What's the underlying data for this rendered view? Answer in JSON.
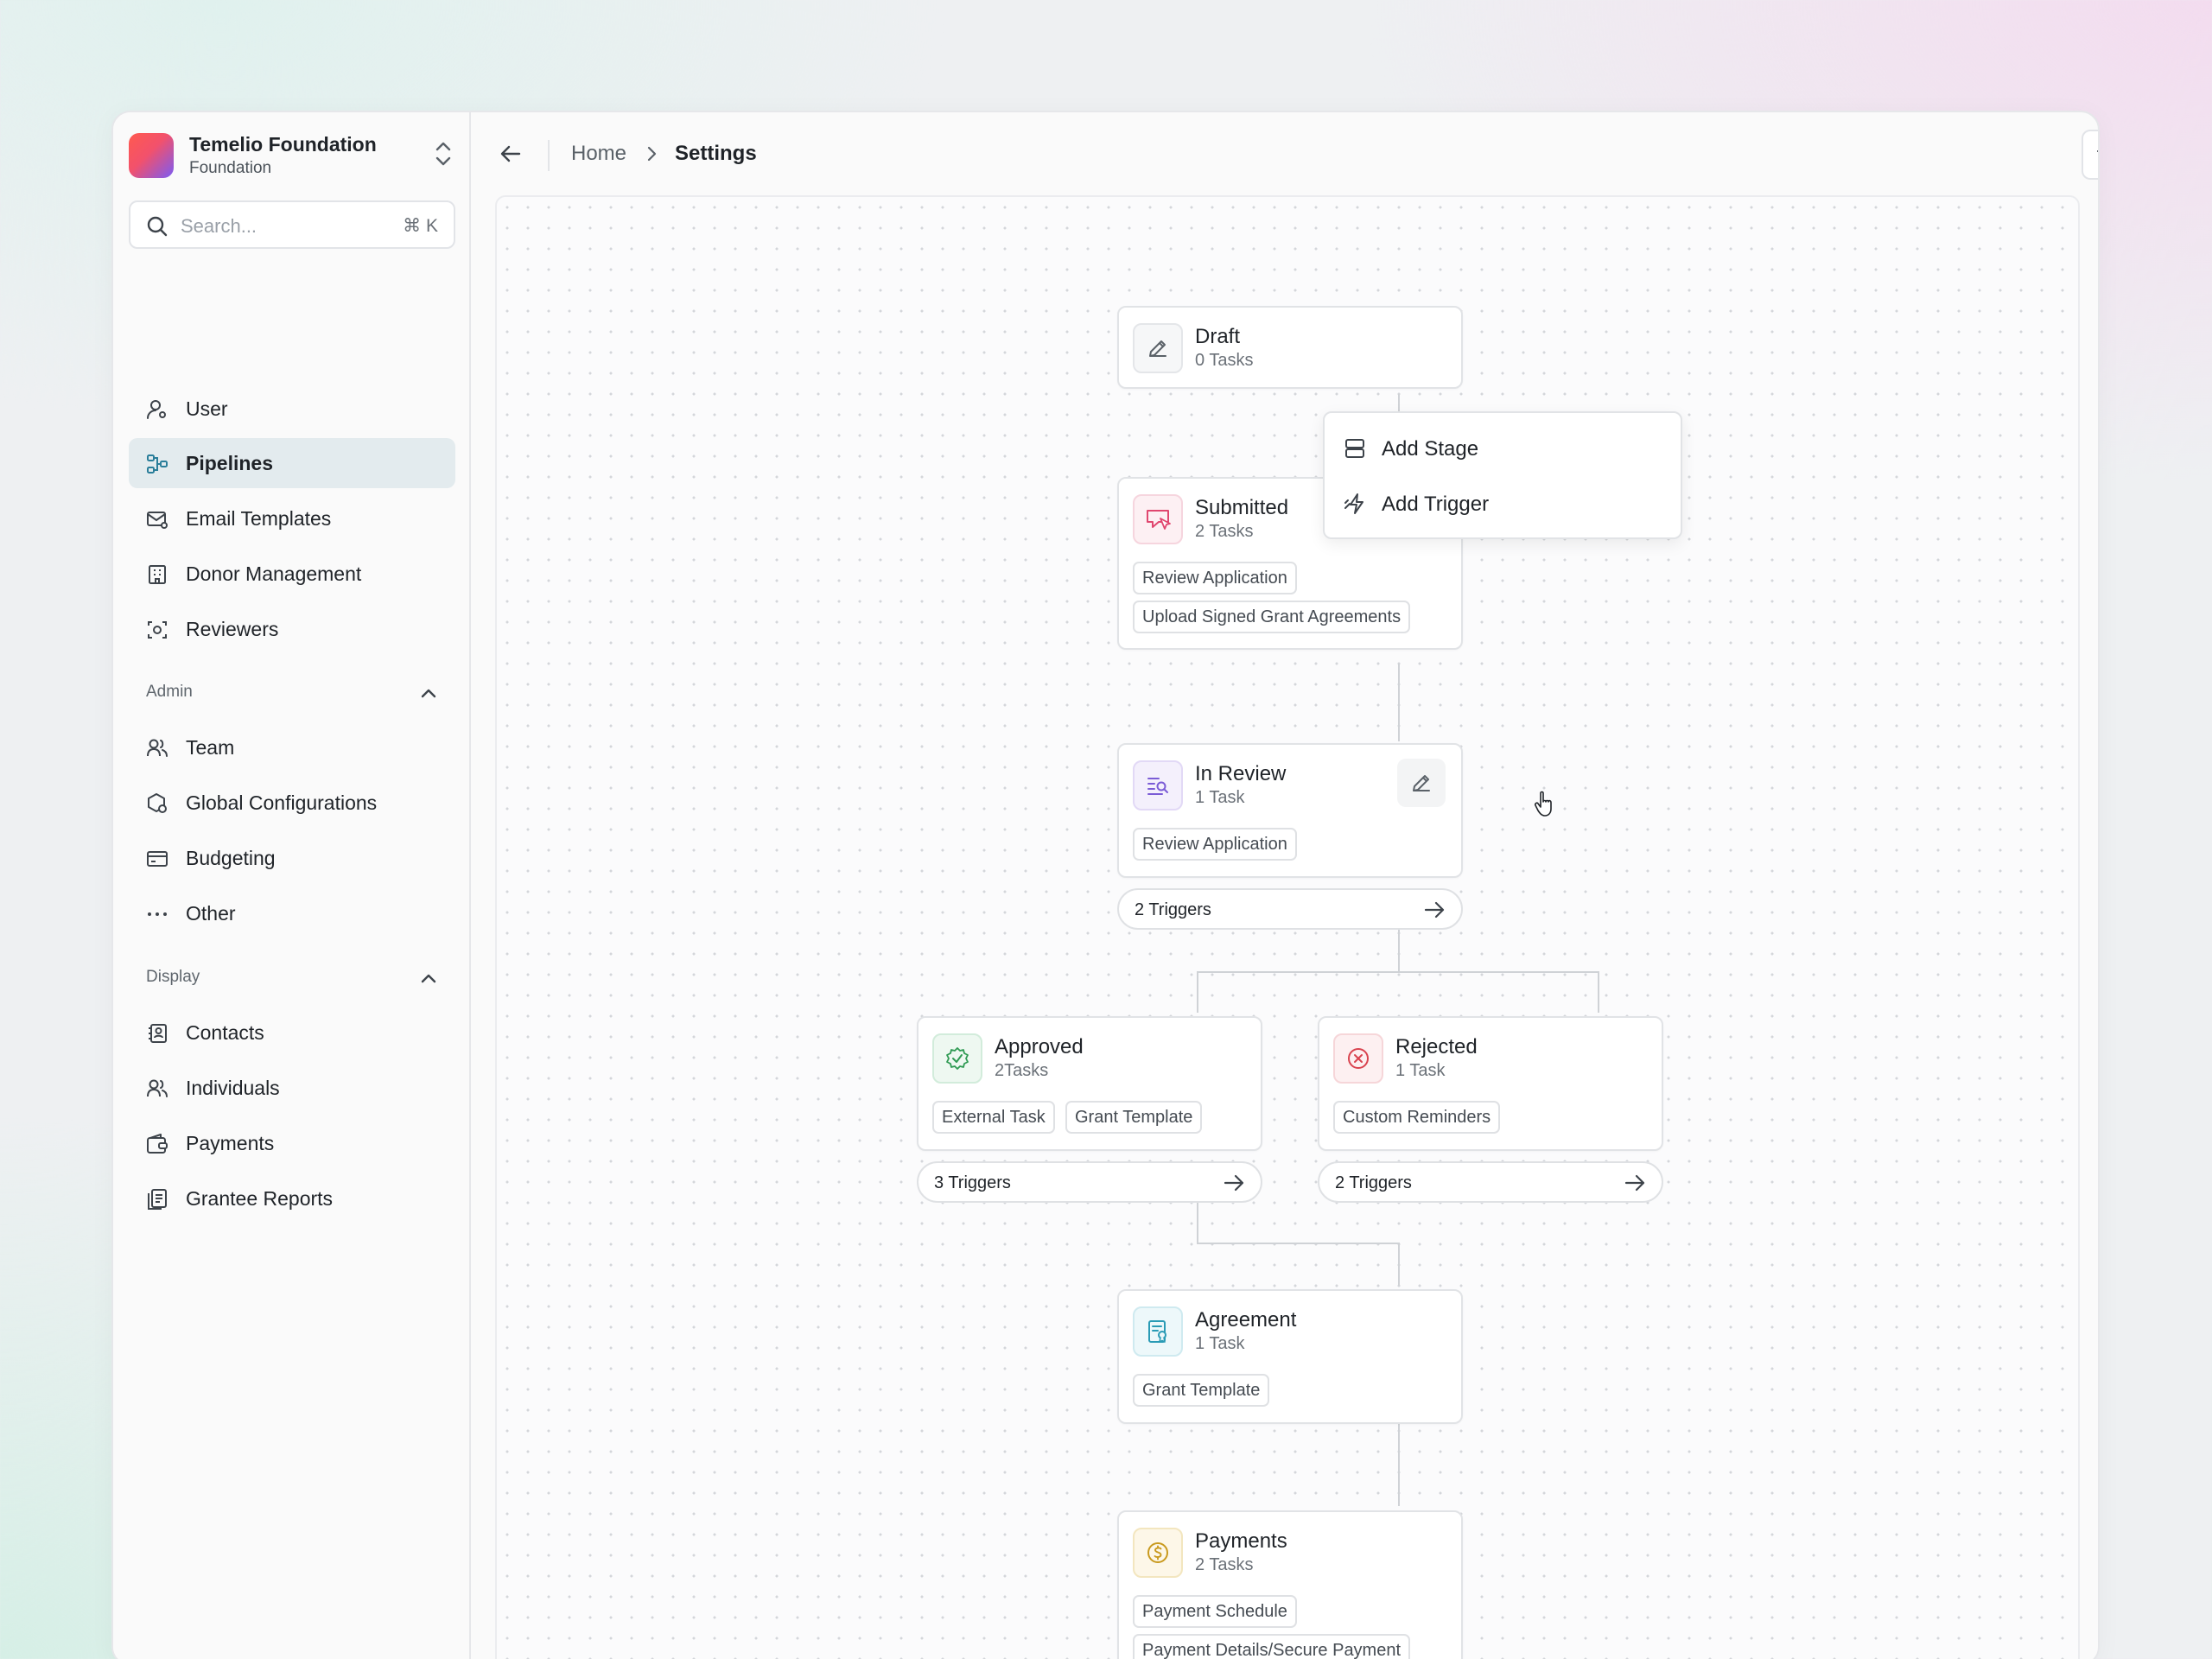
{
  "org": {
    "name": "Temelio Foundation",
    "type": "Foundation"
  },
  "search": {
    "placeholder": "Search...",
    "shortcut": "⌘ K"
  },
  "nav": {
    "main": [
      {
        "label": "User",
        "icon": "user-settings-icon"
      },
      {
        "label": "Pipelines",
        "icon": "pipeline-icon",
        "active": true
      },
      {
        "label": "Email Templates",
        "icon": "email-template-icon"
      },
      {
        "label": "Donor Management",
        "icon": "building-icon"
      },
      {
        "label": "Reviewers",
        "icon": "reviewer-icon"
      }
    ],
    "admin_label": "Admin",
    "admin": [
      {
        "label": "Team",
        "icon": "team-icon"
      },
      {
        "label": "Global Configurations",
        "icon": "config-icon"
      },
      {
        "label": "Budgeting",
        "icon": "budget-icon"
      },
      {
        "label": "Other",
        "icon": "more-icon"
      }
    ],
    "display_label": "Display",
    "display": [
      {
        "label": "Contacts",
        "icon": "contacts-icon"
      },
      {
        "label": "Individuals",
        "icon": "individuals-icon"
      },
      {
        "label": "Payments",
        "icon": "wallet-icon"
      },
      {
        "label": "Grantee Reports",
        "icon": "reports-icon"
      }
    ]
  },
  "breadcrumb": {
    "home": "Home",
    "current": "Settings"
  },
  "menu": {
    "add_stage": "Add Stage",
    "add_trigger": "Add Trigger"
  },
  "stages": {
    "draft": {
      "title": "Draft",
      "tasks": "0 Tasks"
    },
    "submitted": {
      "title": "Submitted",
      "tasks": "2 Tasks",
      "tags": [
        "Review Application",
        "Upload Signed Grant Agreements"
      ]
    },
    "in_review": {
      "title": "In Review",
      "tasks": "1 Task",
      "tags": [
        "Review Application"
      ],
      "triggers": "2 Triggers"
    },
    "approved": {
      "title": "Approved",
      "tasks": "2Tasks",
      "tags": [
        "External Task",
        "Grant Template"
      ],
      "triggers": "3 Triggers"
    },
    "rejected": {
      "title": "Rejected",
      "tasks": "1 Task",
      "tags": [
        "Custom Reminders"
      ],
      "triggers": "2 Triggers"
    },
    "agreement": {
      "title": "Agreement",
      "tasks": "1 Task",
      "tags": [
        "Grant Template"
      ]
    },
    "payments": {
      "title": "Payments",
      "tasks": "2 Tasks",
      "tags": [
        "Payment Schedule",
        "Payment Details/Secure Payment"
      ]
    }
  },
  "colors": {
    "accent": "#2a7e9a",
    "submitted": "#e0476f",
    "in_review": "#7b5cd6",
    "approved": "#2f9a53",
    "rejected": "#d9434f",
    "agreement": "#2a9bb5",
    "payments": "#c99a1e"
  }
}
